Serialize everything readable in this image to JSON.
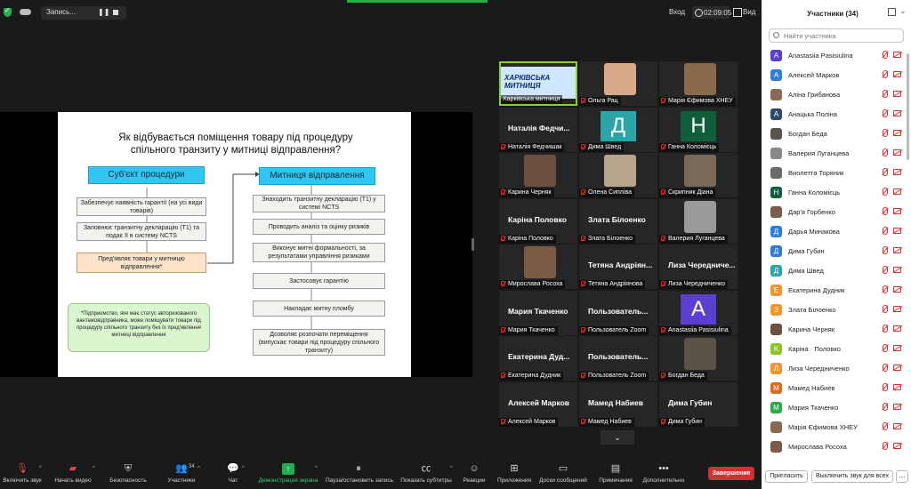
{
  "topbar": {
    "recording_label": "Запись...",
    "pause_icon": "pause-icon",
    "stop_icon": "stop-icon",
    "view_label": "Вход",
    "timer": "02:09:05",
    "view_mode_label": "Вид"
  },
  "slide": {
    "title_line1": "Як відбувається поміщення товару під процедуру",
    "title_line2": "спільного транзиту у митниці відправлення?",
    "left_header": "Суб'єкт процедури",
    "right_header": "Митниця відправлення",
    "left_boxes": [
      "Забезпечує наявність гарантії (на усі види товарів)",
      "Заповнює транзитну декларацію (Т1) та подає її в систему NCTS",
      "Пред'являє товари у митницю відправлення*"
    ],
    "right_boxes": [
      "Знаходить транзитну декларацію (Т1) у системі NCTS",
      "Проводить аналіз та оцінку ризиків",
      "Виконує митні формальності, за результатами управління ризиками",
      "Застосовує гарантію",
      "Накладає митну пломбу",
      "Дозволяє розпочати переміщення (випускає товари під процедуру спільного транзиту)"
    ],
    "note": "*Підприємство, яке має статус авторизованого вантажовідправника, може поміщувати товари під процедуру спільного транзиту без їх пред'явлення митниці відправлення"
  },
  "gallery": {
    "tiles": [
      {
        "label": "Харківська митниця",
        "type": "banner",
        "banner_text": "ХАРКІВСЬКА МИТНИЦЯ",
        "muted": false,
        "active": true
      },
      {
        "label": "Ольга Рац",
        "type": "photo",
        "color": "#d9a98a",
        "muted": true
      },
      {
        "label": "Марія Єфимова ХНЕУ",
        "type": "photo",
        "color": "#8a6a4a",
        "muted": true
      },
      {
        "label": "Наталія Федчишак",
        "type": "name",
        "name": "Наталія Федчи...",
        "muted": true
      },
      {
        "label": "Дима Швед",
        "type": "letter",
        "letter": "Д",
        "color": "#2aa6a8",
        "muted": true
      },
      {
        "label": "Ганна Коломієць",
        "type": "letter",
        "letter": "Н",
        "color": "#0f5e3c",
        "muted": true
      },
      {
        "label": "Карина Черняк",
        "type": "photo",
        "color": "#6b4f3f",
        "muted": true
      },
      {
        "label": "Олена Сипліва",
        "type": "photo",
        "color": "#b8a58e",
        "muted": true
      },
      {
        "label": "Скрипник Діана",
        "type": "photo",
        "color": "#7a6858",
        "muted": true
      },
      {
        "label": "Каріна Половко",
        "type": "name",
        "name": "Каріна Половко",
        "muted": true
      },
      {
        "label": "Злата Білоенко",
        "type": "name",
        "name": "Злата Білоенко",
        "muted": true
      },
      {
        "label": "Валерия Луганцева",
        "type": "photo",
        "color": "#9a9a9a",
        "muted": true
      },
      {
        "label": "Мирослава Росоха",
        "type": "photo",
        "color": "#7b5a48",
        "muted": true
      },
      {
        "label": "Тетяна Андріянова",
        "type": "name",
        "name": "Тетяна Андріян...",
        "muted": true
      },
      {
        "label": "Лиза Чередниченко",
        "type": "name",
        "name": "Лиза Чередниче...",
        "muted": true
      },
      {
        "label": "Мария Ткаченко",
        "type": "name",
        "name": "Мария Ткаченко",
        "muted": true
      },
      {
        "label": "Пользователь Zoom",
        "type": "name",
        "name": "Пользователь...",
        "muted": true
      },
      {
        "label": "Anastasiia Pasisiulina",
        "type": "letter",
        "letter": "A",
        "color": "#5b3fd0",
        "muted": true
      },
      {
        "label": "Екатерина Дудник",
        "type": "name",
        "name": "Екатерина Дуд...",
        "muted": true
      },
      {
        "label": "Пользователь Zoom",
        "type": "name",
        "name": "Пользователь...",
        "muted": true
      },
      {
        "label": "Богдан Беда",
        "type": "photo",
        "color": "#5a5448",
        "muted": true
      },
      {
        "label": "Алексей Марков",
        "type": "name",
        "name": "Алексей Марков",
        "muted": true
      },
      {
        "label": "Мамед Набиев",
        "type": "name",
        "name": "Мамед Набиев",
        "muted": true
      },
      {
        "label": "Дима Губин",
        "type": "name",
        "name": "Дима Губин",
        "muted": true
      }
    ],
    "more_label": "⌄"
  },
  "toolbar": {
    "items": [
      {
        "label": "Включить звук",
        "icon": "muted-mic-icon"
      },
      {
        "label": "Начать видео",
        "icon": "video-off-icon"
      },
      {
        "label": "Безопасность",
        "icon": "shield-icon"
      },
      {
        "label": "Участники",
        "icon": "participants-icon",
        "count": "34"
      },
      {
        "label": "Чат",
        "icon": "chat-icon"
      },
      {
        "label": "Демонстрация экрана",
        "icon": "share-screen-icon"
      },
      {
        "label": "Пауза/остановить запись",
        "icon": "pause-record-icon"
      },
      {
        "label": "Показать субтитры",
        "icon": "captions-icon"
      },
      {
        "label": "Реакции",
        "icon": "reactions-icon"
      },
      {
        "label": "Приложения",
        "icon": "apps-icon"
      },
      {
        "label": "Доски сообщений",
        "icon": "whiteboard-icon"
      },
      {
        "label": "Примечания",
        "icon": "notes-icon"
      },
      {
        "label": "Дополнительно",
        "icon": "more-icon"
      }
    ],
    "end_label": "Завершение"
  },
  "panel": {
    "title": "Участники (34)",
    "search_placeholder": "Найти участника",
    "participants": [
      {
        "name": "Anastasiia Pasisiulina",
        "letter": "A",
        "color": "#5b3fd0"
      },
      {
        "name": "Алексей Марков",
        "letter": "А",
        "color": "#2b7de0"
      },
      {
        "name": "Аліна Грибанова",
        "letter": "",
        "color": "#8a6a55"
      },
      {
        "name": "Анацька Поліна",
        "letter": "А",
        "color": "#2a4a68"
      },
      {
        "name": "Богдан Беда",
        "letter": "",
        "color": "#5a5448"
      },
      {
        "name": "Валерия Луганцева",
        "letter": "",
        "color": "#888888"
      },
      {
        "name": "Виолетта Торяник",
        "letter": "",
        "color": "#6a6a6a"
      },
      {
        "name": "Ганна Коломієць",
        "letter": "Н",
        "color": "#0f5e3c"
      },
      {
        "name": "Дар'я Горбенко",
        "letter": "",
        "color": "#7a5c4a"
      },
      {
        "name": "Дарья Минакова",
        "letter": "Д",
        "color": "#2b7de0"
      },
      {
        "name": "Дима Губин",
        "letter": "Д",
        "color": "#2b7de0"
      },
      {
        "name": "Дима Швед",
        "letter": "Д",
        "color": "#2aa6a8"
      },
      {
        "name": "Екатерина Дудник",
        "letter": "E",
        "color": "#f0962a"
      },
      {
        "name": "Злата Білоенко",
        "letter": "З",
        "color": "#f0962a"
      },
      {
        "name": "Карина Черняк",
        "letter": "",
        "color": "#6b4f3f"
      },
      {
        "name": "Каріна · Половко",
        "letter": "K",
        "color": "#8cc42a"
      },
      {
        "name": "Лиза Чередниченко",
        "letter": "Л",
        "color": "#f0962a"
      },
      {
        "name": "Мамед Набиев",
        "letter": "M",
        "color": "#e06a1a"
      },
      {
        "name": "Мария Ткаченко",
        "letter": "M",
        "color": "#2aaa4a"
      },
      {
        "name": "Марія Єфимова ХНЕУ",
        "letter": "",
        "color": "#8a6a4a"
      },
      {
        "name": "Мирослава Росоха",
        "letter": "",
        "color": "#7b5a48"
      }
    ],
    "invite_label": "Пригласить",
    "mute_all_label": "Выключить звук для всех",
    "more_label": "..."
  }
}
